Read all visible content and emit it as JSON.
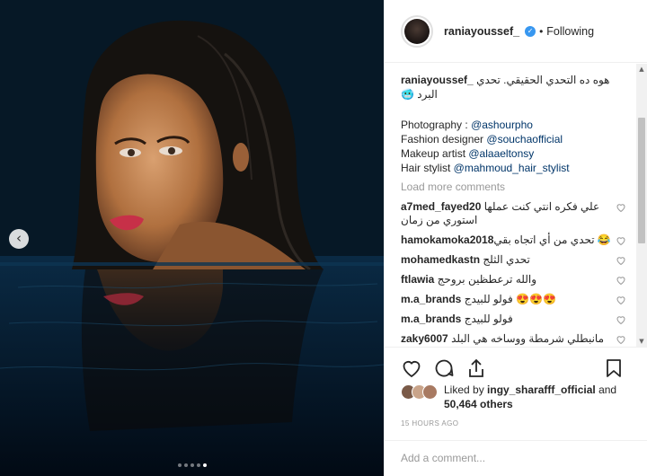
{
  "photo": {
    "prev_icon": "chevron-left-icon",
    "carousel_count": 5,
    "carousel_active": 5
  },
  "header": {
    "username": "raniayoussef_",
    "verified_icon": "verified-badge-icon",
    "separator": "•",
    "follow_state": "Following"
  },
  "caption": {
    "username": "raniayoussef_",
    "text": "هوه ده التحدي الحقيقي. تحدي البرد 🥶",
    "credits": [
      {
        "label": "Photography : ",
        "handle": "@ashourpho"
      },
      {
        "label": "Fashion designer ",
        "handle": "@souchaofficial"
      },
      {
        "label": "Makeup artist ",
        "handle": "@alaaeltonsy"
      },
      {
        "label": "Hair stylist ",
        "handle": "@mahmoud_hair_stylist"
      }
    ]
  },
  "load_more": "Load more comments",
  "comments": [
    {
      "user": "a7med_fayed20",
      "text": "علي فكره انتي كنت عملها استوري من زمان"
    },
    {
      "user": "hamokamoka2018",
      "text": "تحدي من أي اتجاه بقي 😂"
    },
    {
      "user": "mohamedkastn",
      "text": "تحدي الثلج"
    },
    {
      "user": "ftlawia",
      "text": "والله ترعطظين بروحج"
    },
    {
      "user": "m.a_brands",
      "text": "فولو للبيدج 😍😍😍"
    },
    {
      "user": "m.a_brands",
      "text": "فولو للبيدج"
    },
    {
      "user": "zaky6007",
      "text": "مانبطلي شرمطة ووساخه هي البلد ناقصة روحي صلي واستغفري ربنا يا كافره"
    }
  ],
  "likes": {
    "prefix": "Liked by ",
    "top_liker": "ingy_sharafff_official",
    "middle": " and ",
    "count": "50,464 others"
  },
  "time_ago": "15 HOURS AGO",
  "add_comment_placeholder": "Add a comment..."
}
